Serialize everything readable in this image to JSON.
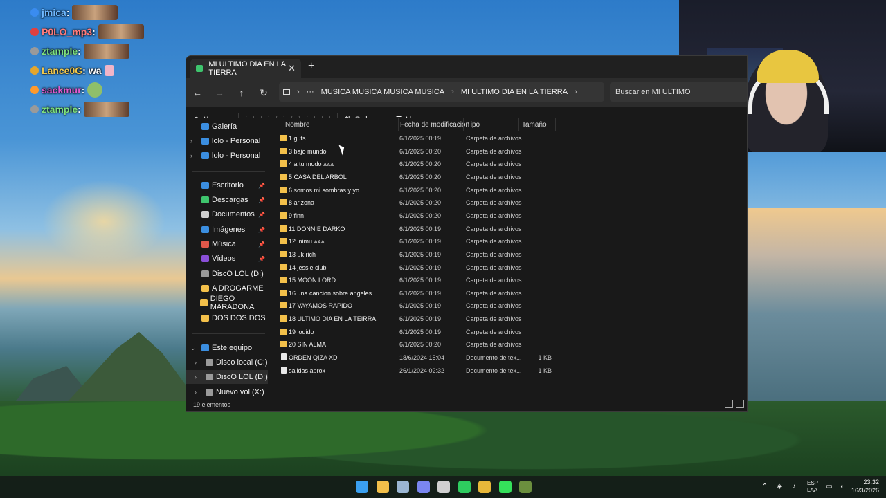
{
  "chat": [
    {
      "user": "jmica",
      "sep": ":",
      "user_color": "#6fb8ff",
      "badge_color": "#3a8cf0",
      "emote": "pig-emote"
    },
    {
      "user": "P0LO_mp3",
      "sep": ":",
      "user_color": "#ff7b7b",
      "badge_color": "#e04040",
      "emote": "cup-emote"
    },
    {
      "user": "ztample",
      "sep": ":",
      "user_color": "#7de07d",
      "badge_color": "#9a9a9a",
      "emote": "pig-emote"
    },
    {
      "user": "Lance0G",
      "sep": ":",
      "message": "wa",
      "user_color": "#f3c94b",
      "badge_color": "#e5a62c",
      "emote": "pink-emote"
    },
    {
      "user": "sackmur",
      "sep": ":",
      "user_color": "#e05ad0",
      "badge_color": "#ff9a2c",
      "emote": "frog-emote"
    },
    {
      "user": "ztample",
      "sep": ":",
      "user_color": "#7de07d",
      "badge_color": "#9a9a9a",
      "emote": "pig-emote"
    }
  ],
  "explorer": {
    "tab_title": "MI ULTIMO DIA EN LA TIERRA",
    "breadcrumb": [
      "···",
      "MUSICA MUSICA MUSICA MUSICA",
      "MI ULTIMO DIA EN LA TIERRA"
    ],
    "search_placeholder": "Buscar en MI ULTIMO",
    "toolbar": {
      "new": "Nuevo",
      "sort": "Ordenar",
      "view": "Ver",
      "more": "···"
    },
    "columns": {
      "name": "Nombre",
      "date": "Fecha de modificación",
      "type": "Tipo",
      "size": "Tamaño"
    },
    "sidebar": [
      {
        "label": "Galería",
        "icon": "gallery-icon",
        "color": "#3b8ee0"
      },
      {
        "label": "lolo - Personal",
        "icon": "onedrive-icon",
        "color": "#3b8ee0",
        "expand": true
      },
      {
        "label": "lolo - Personal",
        "icon": "onedrive-icon",
        "color": "#3b8ee0",
        "expand": true
      },
      {
        "label": "Escritorio",
        "icon": "desktop-icon",
        "color": "#3b8ee0",
        "pinned": true
      },
      {
        "label": "Descargas",
        "icon": "download-icon",
        "color": "#3ec46d",
        "pinned": true
      },
      {
        "label": "Documentos",
        "icon": "document-icon",
        "color": "#cfcfcf",
        "pinned": true
      },
      {
        "label": "Imágenes",
        "icon": "pictures-icon",
        "color": "#3b8ee0",
        "pinned": true
      },
      {
        "label": "Música",
        "icon": "music-icon",
        "color": "#e0574a",
        "pinned": true
      },
      {
        "label": "Vídeos",
        "icon": "videos-icon",
        "color": "#8a4fd8",
        "pinned": true
      },
      {
        "label": "DiscO LOL (D:)",
        "icon": "drive-icon",
        "color": "#9a9a9a"
      },
      {
        "label": "A DROGARME",
        "icon": "folder-icon",
        "color": "#f3c04a"
      },
      {
        "label": "DIEGO MARADONA",
        "icon": "folder-icon",
        "color": "#f3c04a"
      },
      {
        "label": "DOS DOS DOS",
        "icon": "folder-icon",
        "color": "#f3c04a"
      },
      {
        "label": "Este equipo",
        "icon": "pc-icon",
        "color": "#3b8ee0",
        "expand": true
      },
      {
        "label": "Disco local (C:)",
        "icon": "drive-icon",
        "color": "#9a9a9a",
        "expand": true
      },
      {
        "label": "DiscO LOL (D:)",
        "icon": "drive-icon",
        "color": "#9a9a9a",
        "expand": true
      },
      {
        "label": "Nuevo vol (X:)",
        "icon": "drive-icon",
        "color": "#9a9a9a",
        "expand": true
      }
    ],
    "files": [
      {
        "name": "1 guts",
        "date": "6/1/2025 00:19",
        "type": "Carpeta de archivos",
        "size": ""
      },
      {
        "name": "3 bajo mundo",
        "date": "6/1/2025 00:20",
        "type": "Carpeta de archivos",
        "size": ""
      },
      {
        "name": "4 a tu modo ⩓⩓⩓",
        "date": "6/1/2025 00:20",
        "type": "Carpeta de archivos",
        "size": ""
      },
      {
        "name": "5 CASA DEL ARBOL",
        "date": "6/1/2025 00:20",
        "type": "Carpeta de archivos",
        "size": ""
      },
      {
        "name": "6 somos mi sombras y yo",
        "date": "6/1/2025 00:20",
        "type": "Carpeta de archivos",
        "size": ""
      },
      {
        "name": "8 arizona",
        "date": "6/1/2025 00:20",
        "type": "Carpeta de archivos",
        "size": ""
      },
      {
        "name": "9 finn",
        "date": "6/1/2025 00:20",
        "type": "Carpeta de archivos",
        "size": ""
      },
      {
        "name": "11 DONNIE DARKO",
        "date": "6/1/2025 00:19",
        "type": "Carpeta de archivos",
        "size": ""
      },
      {
        "name": "12 inimu ⩓⩓⩓",
        "date": "6/1/2025 00:19",
        "type": "Carpeta de archivos",
        "size": ""
      },
      {
        "name": "13 uk rich",
        "date": "6/1/2025 00:19",
        "type": "Carpeta de archivos",
        "size": ""
      },
      {
        "name": "14 jessie club",
        "date": "6/1/2025 00:19",
        "type": "Carpeta de archivos",
        "size": ""
      },
      {
        "name": "15 MOON LORD",
        "date": "6/1/2025 00:19",
        "type": "Carpeta de archivos",
        "size": ""
      },
      {
        "name": "16 una cancion sobre angeles",
        "date": "6/1/2025 00:19",
        "type": "Carpeta de archivos",
        "size": ""
      },
      {
        "name": "17 VAYAMOS RAPIDO",
        "date": "6/1/2025 00:19",
        "type": "Carpeta de archivos",
        "size": ""
      },
      {
        "name": "18 ULTIMO DIA EN LA TEIRRA",
        "date": "6/1/2025 00:19",
        "type": "Carpeta de archivos",
        "size": ""
      },
      {
        "name": "19 jodido",
        "date": "6/1/2025 00:19",
        "type": "Carpeta de archivos",
        "size": ""
      },
      {
        "name": "20 SIN ALMA",
        "date": "6/1/2025 00:20",
        "type": "Carpeta de archivos",
        "size": ""
      },
      {
        "name": "ORDEN QIZA XD",
        "date": "18/6/2024 15:04",
        "type": "Documento de tex...",
        "size": "1 KB",
        "doc": true
      },
      {
        "name": "salidas aprox",
        "date": "26/1/2024 02:32",
        "type": "Documento de tex...",
        "size": "1 KB",
        "doc": true
      }
    ],
    "status": "19 elementos"
  },
  "taskbar": {
    "apps": [
      {
        "name": "start-icon",
        "color": "#3ba0f0"
      },
      {
        "name": "file-explorer-icon",
        "color": "#f3c04a",
        "active": true
      },
      {
        "name": "steam-icon",
        "color": "#9bb6d3"
      },
      {
        "name": "discord-icon",
        "color": "#7a86f0"
      },
      {
        "name": "chatgpt-icon",
        "color": "#d0d0d0"
      },
      {
        "name": "spotify-icon",
        "color": "#2ecc5f"
      },
      {
        "name": "chrome-icon",
        "color": "#e8b83a"
      },
      {
        "name": "kick-icon",
        "color": "#35e15b"
      },
      {
        "name": "minecraft-icon",
        "color": "#6b8f3e"
      }
    ],
    "lang": "ESP",
    "lang_sub": "LAA",
    "time": "23:32",
    "date": "16/3/2026"
  }
}
